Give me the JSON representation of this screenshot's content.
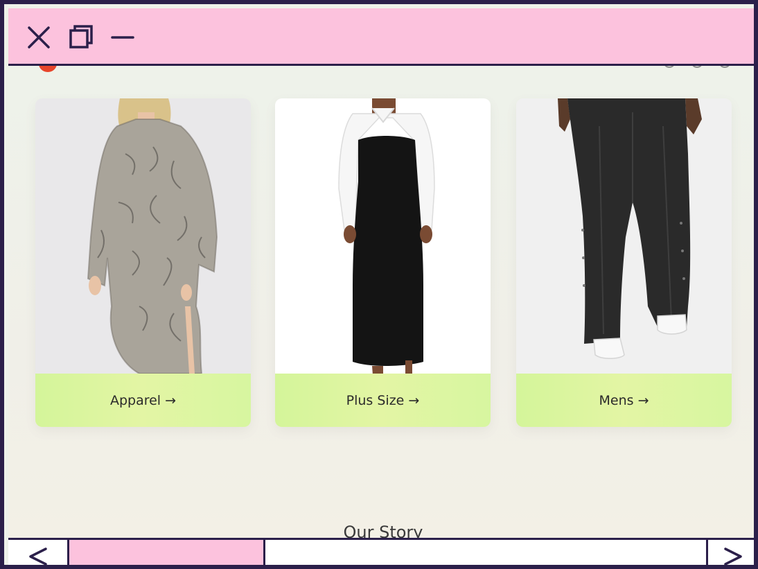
{
  "window": {
    "controls": {
      "close_icon": "close-icon",
      "maximize_icon": "maximize-icon",
      "minimize_icon": "minimize-icon"
    },
    "accent_color": "#fcc2dd",
    "frame_color": "#2b1f4a"
  },
  "categories": [
    {
      "label": "Apparel →",
      "image": "woman in printed maxi dress"
    },
    {
      "label": "Plus Size →",
      "image": "woman in black and white midi dress"
    },
    {
      "label": "Mens →",
      "image": "man in black wide-leg trousers"
    }
  ],
  "sections": {
    "story_heading": "Our Story"
  },
  "bottom_bar": {
    "back_icon": "chevron-left-icon",
    "forward_icon": "chevron-right-icon"
  },
  "colors": {
    "card_label_bg": "#d8f5a0",
    "page_bg": "#eef2ea",
    "logo_red": "#e7452b"
  }
}
